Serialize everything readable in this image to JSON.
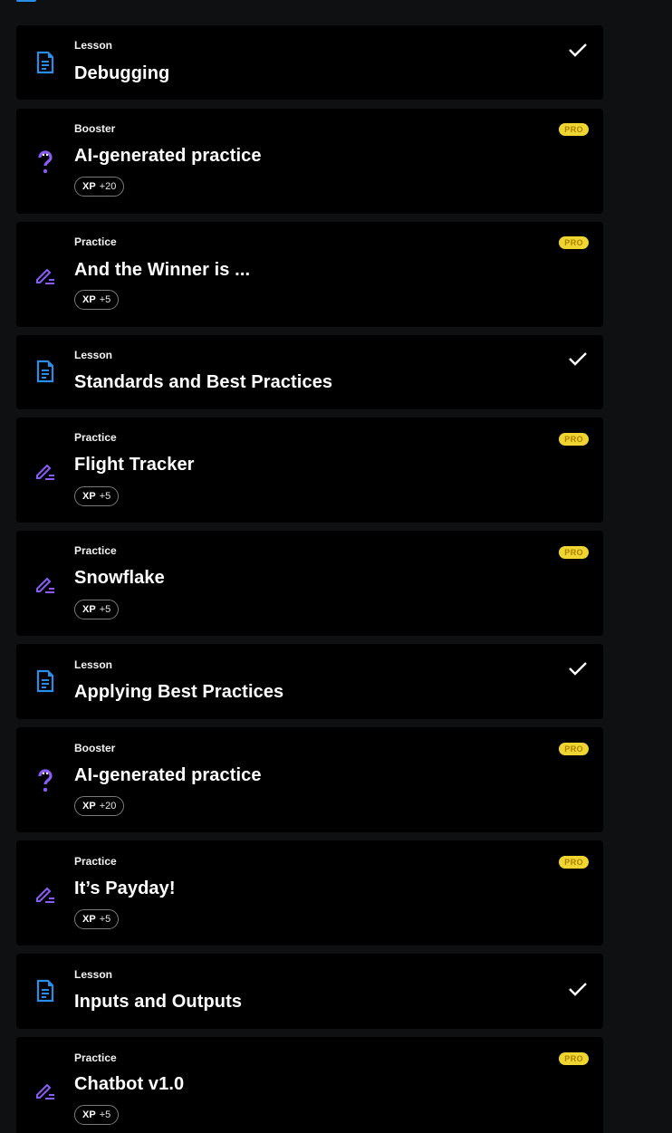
{
  "colors": {
    "background": "#0f1012",
    "card": "#000000",
    "lesson_icon": "#2a8de8",
    "practice_icon": "#8a5cf6",
    "booster_icon": "#8a5cf6",
    "pro_badge": "#fbe134",
    "check": "#ffffff"
  },
  "items": [
    {
      "type": "Lesson",
      "title": "Debugging",
      "icon": "lesson-document-icon",
      "completed": true
    },
    {
      "type": "Booster",
      "title": "AI-generated practice",
      "icon": "booster-question-icon",
      "pro": "PRO",
      "xp_label": "XP",
      "xp_value": "+20"
    },
    {
      "type": "Practice",
      "title": "And the Winner is ...",
      "icon": "practice-pencil-icon",
      "pro": "PRO",
      "xp_label": "XP",
      "xp_value": "+5"
    },
    {
      "type": "Lesson",
      "title": "Standards and Best Practices",
      "icon": "lesson-document-icon",
      "completed": true
    },
    {
      "type": "Practice",
      "title": "Flight Tracker",
      "icon": "practice-pencil-icon",
      "pro": "PRO",
      "xp_label": "XP",
      "xp_value": "+5"
    },
    {
      "type": "Practice",
      "title": "Snowflake",
      "icon": "practice-pencil-icon",
      "pro": "PRO",
      "xp_label": "XP",
      "xp_value": "+5"
    },
    {
      "type": "Lesson",
      "title": "Applying Best Practices",
      "icon": "lesson-document-icon",
      "completed": true
    },
    {
      "type": "Booster",
      "title": "AI-generated practice",
      "icon": "booster-question-icon",
      "pro": "PRO",
      "xp_label": "XP",
      "xp_value": "+20"
    },
    {
      "type": "Practice",
      "title": "It’s Payday!",
      "icon": "practice-pencil-icon",
      "pro": "PRO",
      "xp_label": "XP",
      "xp_value": "+5"
    },
    {
      "type": "Lesson",
      "title": "Inputs and Outputs",
      "icon": "lesson-document-icon",
      "completed": true
    },
    {
      "type": "Practice",
      "title": "Chatbot v1.0",
      "icon": "practice-pencil-icon",
      "pro": "PRO",
      "xp_label": "XP",
      "xp_value": "+5"
    }
  ]
}
